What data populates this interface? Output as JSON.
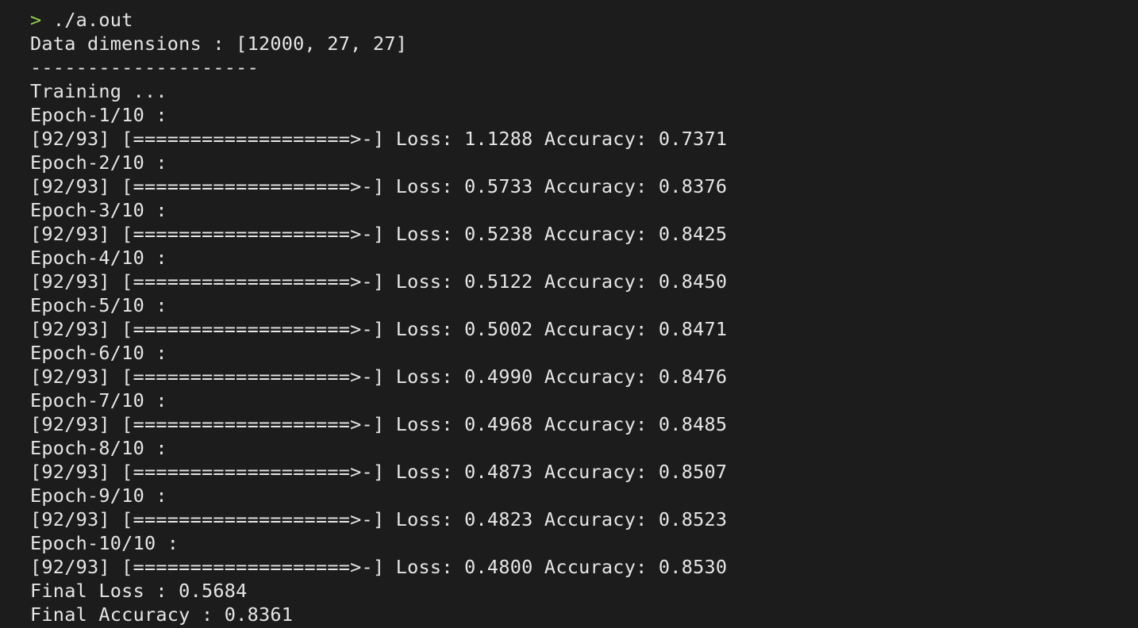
{
  "terminal": {
    "prompt_symbol": ">",
    "command": "./a.out",
    "data_dims": "Data dimensions : [12000, 27, 27]",
    "separator": "--------------------",
    "training": "Training ...",
    "epochs": [
      {
        "header": "Epoch-1/10 :",
        "progress": "[92/93] [===================>-] Loss: 1.1288 Accuracy: 0.7371"
      },
      {
        "header": "Epoch-2/10 :",
        "progress": "[92/93] [===================>-] Loss: 0.5733 Accuracy: 0.8376"
      },
      {
        "header": "Epoch-3/10 :",
        "progress": "[92/93] [===================>-] Loss: 0.5238 Accuracy: 0.8425"
      },
      {
        "header": "Epoch-4/10 :",
        "progress": "[92/93] [===================>-] Loss: 0.5122 Accuracy: 0.8450"
      },
      {
        "header": "Epoch-5/10 :",
        "progress": "[92/93] [===================>-] Loss: 0.5002 Accuracy: 0.8471"
      },
      {
        "header": "Epoch-6/10 :",
        "progress": "[92/93] [===================>-] Loss: 0.4990 Accuracy: 0.8476"
      },
      {
        "header": "Epoch-7/10 :",
        "progress": "[92/93] [===================>-] Loss: 0.4968 Accuracy: 0.8485"
      },
      {
        "header": "Epoch-8/10 :",
        "progress": "[92/93] [===================>-] Loss: 0.4873 Accuracy: 0.8507"
      },
      {
        "header": "Epoch-9/10 :",
        "progress": "[92/93] [===================>-] Loss: 0.4823 Accuracy: 0.8523"
      },
      {
        "header": "Epoch-10/10 :",
        "progress": "[92/93] [===================>-] Loss: 0.4800 Accuracy: 0.8530"
      }
    ],
    "final_loss": "Final Loss : 0.5684",
    "final_accuracy": "Final Accuracy : 0.8361",
    "colors": {
      "background": "#1c1c1c",
      "text": "#e6e6e6",
      "prompt": "#8fd14f"
    }
  }
}
